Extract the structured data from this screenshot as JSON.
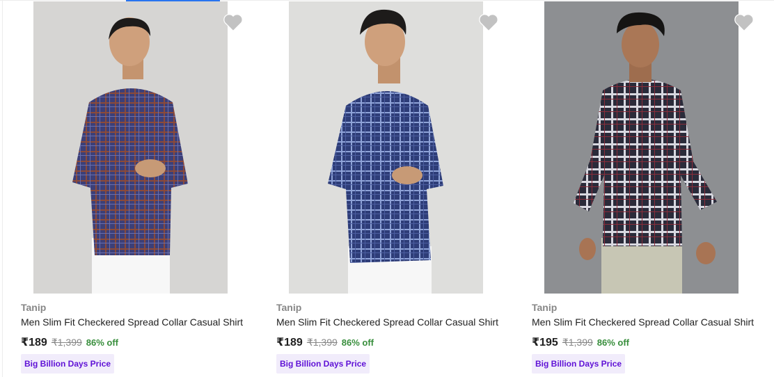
{
  "products": [
    {
      "brand": "Tanip",
      "title": "Men Slim Fit Checkered Spread Collar Casual Shirt",
      "price": "₹189",
      "mrp": "₹1,399",
      "discount": "86% off",
      "badge": "Big Billion Days Price",
      "image": "man-in-brown-navy-checkered-shirt",
      "wishlist_icon": "heart-icon"
    },
    {
      "brand": "Tanip",
      "title": "Men Slim Fit Checkered Spread Collar Casual Shirt",
      "price": "₹189",
      "mrp": "₹1,399",
      "discount": "86% off",
      "badge": "Big Billion Days Price",
      "image": "man-in-navy-blue-checkered-shirt",
      "wishlist_icon": "heart-icon"
    },
    {
      "brand": "Tanip",
      "title": "Men Slim Fit Checkered Spread Collar Casual Shirt",
      "price": "₹195",
      "mrp": "₹1,399",
      "discount": "86% off",
      "badge": "Big Billion Days Price",
      "image": "man-in-dark-plaid-shirt",
      "wishlist_icon": "heart-icon"
    }
  ],
  "colors": {
    "discount": "#388e3c",
    "badge_text": "#5f11d6",
    "badge_bg": "#f1ecfb",
    "brand_text": "#878787",
    "wishlist_icon": "#c2c2c2",
    "accent": "#2874f0"
  }
}
